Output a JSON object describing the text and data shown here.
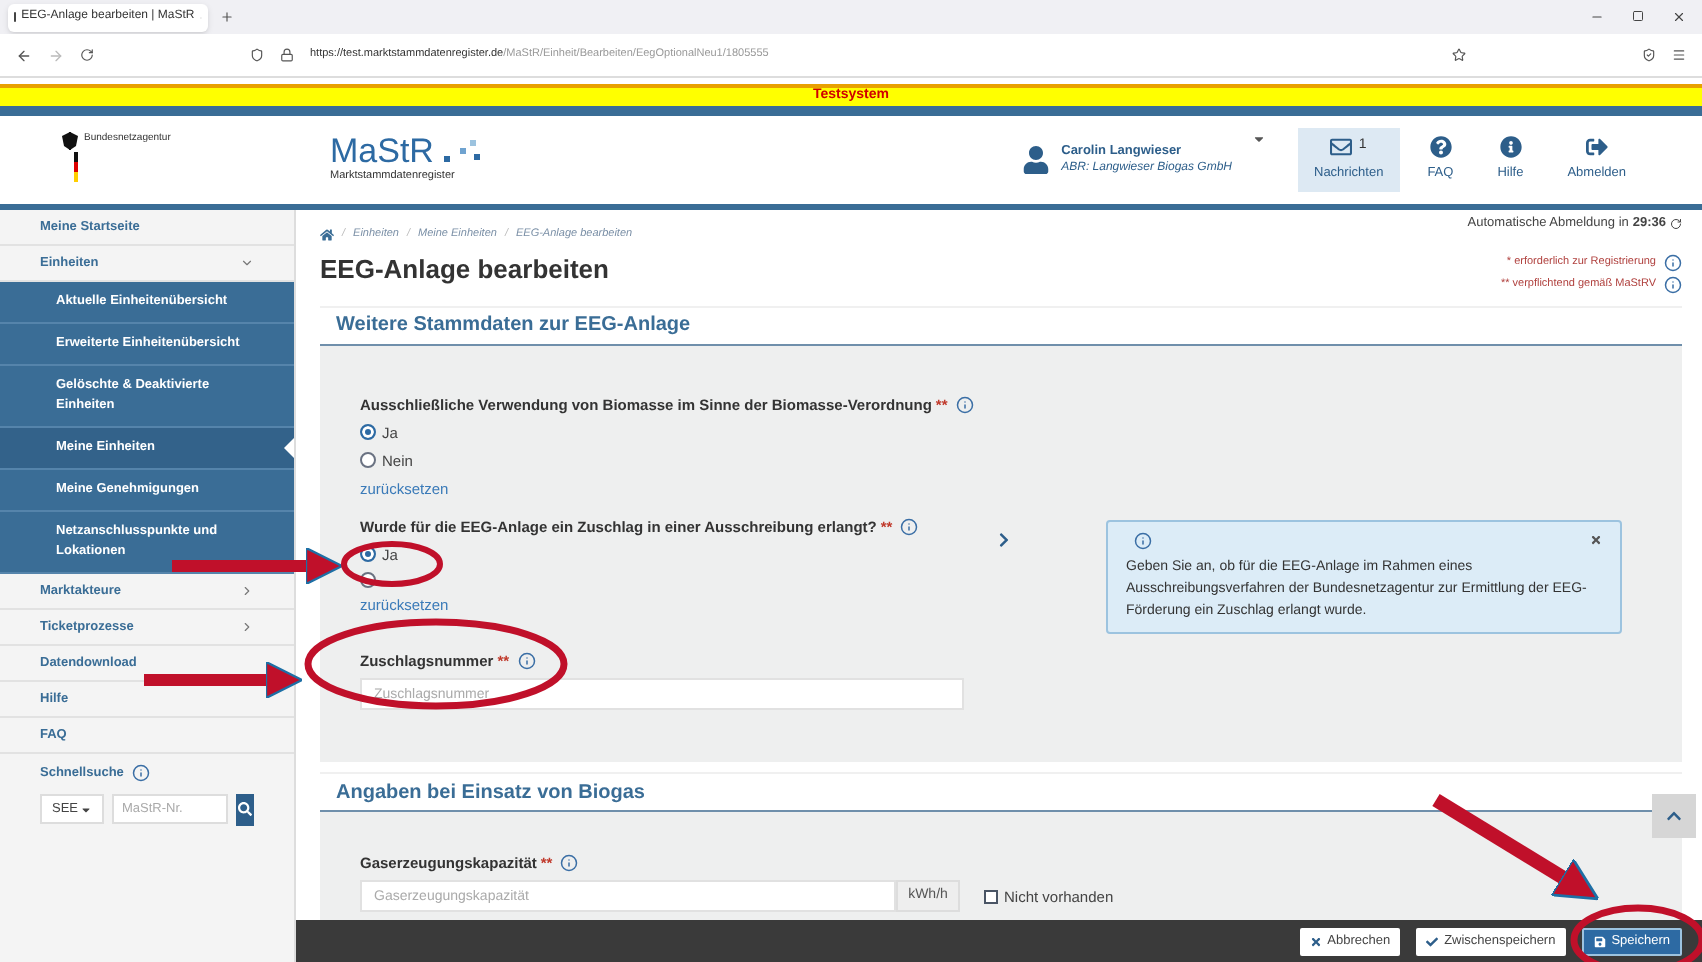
{
  "browser": {
    "tab_title": "EEG-Anlage bearbeiten | MaStR",
    "url_host": "https://test.marktstammdatenregister.de",
    "url_path": "/MaStR/Einheit/Bearbeiten/EegOptionalNeu1/1805555"
  },
  "banner": "Testsystem",
  "header": {
    "agency": "Bundesnetzagentur",
    "logo": "MaStR",
    "logo_sub": "Marktstammdatenregister",
    "user_name": "Carolin Langwieser",
    "user_org": "ABR: Langwieser Biogas GmbH",
    "actions": [
      {
        "kind": "messages",
        "label": "Nachrichten",
        "count": "1",
        "selected": true
      },
      {
        "kind": "faq",
        "label": "FAQ",
        "selected": false
      },
      {
        "kind": "help",
        "label": "Hilfe",
        "selected": false
      },
      {
        "kind": "logout",
        "label": "Abmelden",
        "selected": false
      }
    ]
  },
  "sidebar": {
    "items": [
      {
        "label": "Meine Startseite",
        "kind": "link"
      },
      {
        "label": "Einheiten",
        "kind": "group",
        "expanded": true,
        "children": [
          {
            "label": "Aktuelle Einheitenübersicht",
            "selected": false
          },
          {
            "label": "Erweiterte Einheitenübersicht",
            "selected": false
          },
          {
            "label": "Gelöschte & Deaktivierte Einheiten",
            "selected": false
          },
          {
            "label": "Meine Einheiten",
            "selected": true
          },
          {
            "label": "Meine Genehmigungen",
            "selected": false
          },
          {
            "label": "Netzanschlusspunkte und Lokationen",
            "selected": false
          }
        ]
      },
      {
        "label": "Marktakteure",
        "kind": "group",
        "expanded": false
      },
      {
        "label": "Ticketprozesse",
        "kind": "group",
        "expanded": false
      },
      {
        "label": "Datendownload",
        "kind": "link"
      },
      {
        "label": "Hilfe",
        "kind": "link"
      },
      {
        "label": "FAQ",
        "kind": "link"
      }
    ],
    "quick_search": {
      "label": "Schnellsuche",
      "select": "SEE",
      "placeholder": "MaStR-Nr."
    }
  },
  "breadcrumb": {
    "separator": "/",
    "items": [
      "Einheiten",
      "Meine Einheiten",
      "EEG-Anlage bearbeiten"
    ]
  },
  "page_title": "EEG-Anlage bearbeiten",
  "session": {
    "text": "Automatische Abmeldung in",
    "time": "29:36"
  },
  "legend": [
    "* erforderlich zur Registrierung",
    "** verpflichtend gemäß MaStRV"
  ],
  "sections": [
    {
      "title": "Weitere Stammdaten zur EEG-Anlage",
      "fields": [
        {
          "kind": "radio",
          "label": "Ausschließliche Verwendung von Biomasse im Sinne der Biomasse-Verordnung",
          "required": "**",
          "options": [
            {
              "label": "Ja",
              "selected": true
            },
            {
              "label": "Nein",
              "selected": false
            }
          ],
          "reset": "zurücksetzen"
        },
        {
          "kind": "radio",
          "label": "Wurde für die EEG-Anlage ein Zuschlag in einer Ausschreibung erlangt?",
          "required": "**",
          "options": [
            {
              "label": "Ja",
              "selected": true
            },
            {
              "selected": false
            }
          ],
          "reset": "zurücksetzen",
          "help": "Geben Sie an, ob für die EEG-Anlage im Rahmen eines Ausschreibungsverfahren der Bundesnetzagentur zur Ermittlung der EEG-Förderung ein Zuschlag erlangt wurde."
        },
        {
          "kind": "text",
          "label": "Zuschlagsnummer",
          "required": "**",
          "placeholder": "Zuschlagsnummer"
        }
      ]
    },
    {
      "title": "Angaben bei Einsatz von Biogas",
      "fields": [
        {
          "kind": "unit",
          "label": "Gaserzeugungskapazität",
          "required": "**",
          "placeholder": "Gaserzeugungskapazität",
          "unit": "kWh/h",
          "checkbox": {
            "label": "Nicht vorhanden",
            "checked": false
          }
        }
      ]
    }
  ],
  "footer": [
    {
      "kind": "cancel",
      "label": "Abbrechen"
    },
    {
      "kind": "draft",
      "label": "Zwischenspeichern"
    },
    {
      "kind": "save",
      "label": "Speichern"
    }
  ]
}
